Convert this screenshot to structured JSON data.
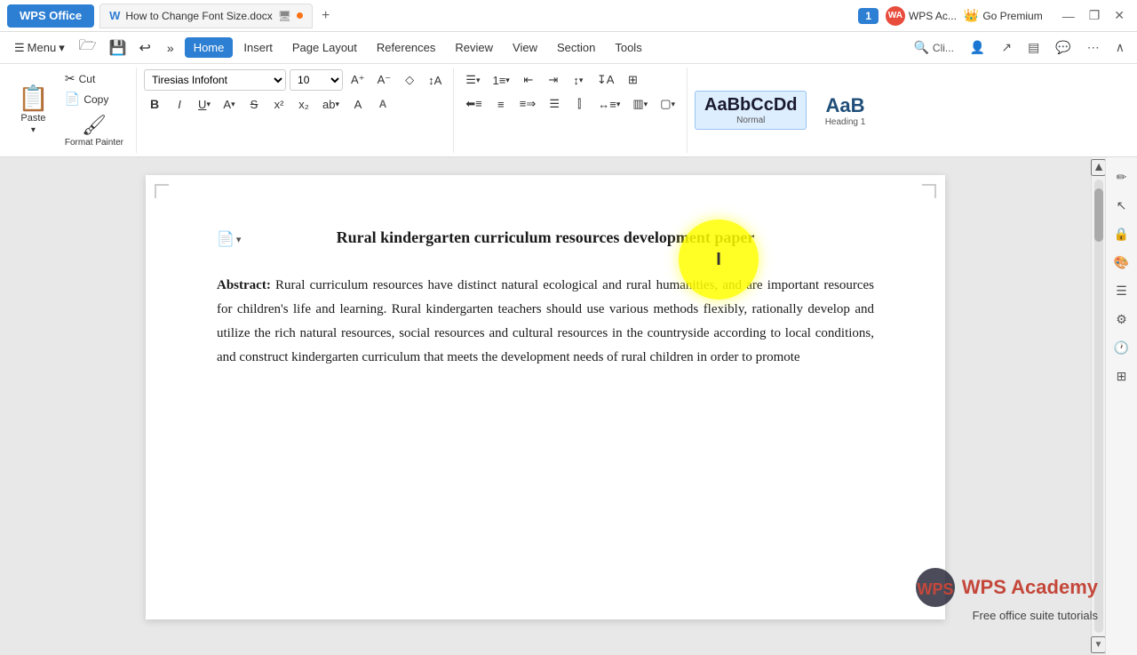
{
  "titleBar": {
    "wpsLabel": "WPS Office",
    "docName": "How to Change Font Size.docx",
    "newTabIcon": "+",
    "notificationCount": "1",
    "wpsAcLabel": "WPS Ac...",
    "wpsAcInitials": "WA",
    "goPremiumLabel": "Go Premium",
    "winControls": [
      "—",
      "❐",
      "✕"
    ]
  },
  "menuBar": {
    "hamburger": "≡",
    "menuLabel": "Menu",
    "items": [
      {
        "label": "Home",
        "active": true
      },
      {
        "label": "Insert",
        "active": false
      },
      {
        "label": "Page Layout",
        "active": false
      },
      {
        "label": "References",
        "active": false
      },
      {
        "label": "Review",
        "active": false
      },
      {
        "label": "View",
        "active": false
      },
      {
        "label": "Section",
        "active": false
      },
      {
        "label": "Tools",
        "active": false
      }
    ],
    "searchPlaceholder": "Cli...",
    "rightIcons": [
      "👤",
      "↗",
      "▤",
      "💬",
      "⋯",
      "∧"
    ]
  },
  "ribbon": {
    "clipboard": {
      "pasteIcon": "📋",
      "pasteLabel": "Paste",
      "cutIcon": "✂",
      "cutLabel": "Cut",
      "copyIcon": "📄",
      "copyLabel": "Copy",
      "formatPainterIcon": "🖌",
      "formatPainterLabel": "Format Painter"
    },
    "font": {
      "fontName": "Tiresias Infofont",
      "fontSize": "10",
      "incIcon": "A↑",
      "decIcon": "A↓",
      "clearIcon": "◇",
      "sortIcon": "↕",
      "boldLabel": "B",
      "italicLabel": "I",
      "underlineLabel": "U",
      "fontColorLabel": "A",
      "strikeLabel": "S",
      "subLabel": "x₂",
      "supLabel": "x²"
    },
    "paragraph": {
      "bulletIcon": "≡•",
      "numberedIcon": "≡1",
      "outdentIcon": "⇐",
      "indentIcon": "⇒",
      "lineSpacingIcon": "↕",
      "alignLeftIcon": "≡",
      "alignCenterIcon": "≡",
      "alignRightIcon": "≡",
      "alignJustifyIcon": "≡",
      "borderIcon": "⊞",
      "shadingIcon": "▥"
    },
    "styles": {
      "normalPreview": "AaBbCcDd",
      "normalLabel": "Normal",
      "headingPreview": "AaB",
      "headingLabel": "Heading 1"
    }
  },
  "document": {
    "title": "Rural kindergarten curriculum resources development paper",
    "abstractLabel": "Abstract:",
    "abstractText": " Rural curriculum resources have distinct natural ecological and rural humanities, and are important resources for children's life and learning. Rural kindergarten teachers should use various methods flexibly, rationally develop and utilize the rich natural resources, social resources and cultural resources in the countryside according to local conditions, and construct kindergarten curriculum that meets the development needs of rural children in order to promote"
  },
  "wpsAcademy": {
    "logoText": "WPS Academy",
    "tagline": "Free office suite tutorials"
  },
  "cursorHighlight": {
    "symbol": "I"
  }
}
